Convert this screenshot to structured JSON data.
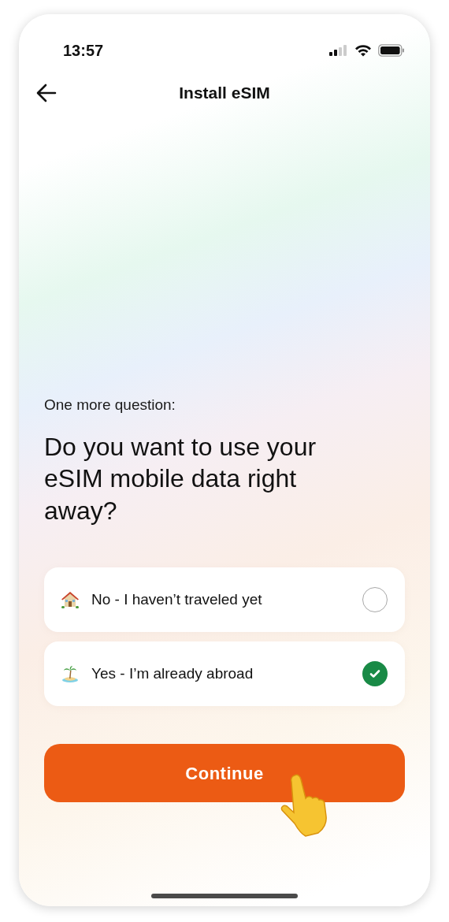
{
  "status_bar": {
    "time": "13:57"
  },
  "header": {
    "title": "Install eSIM"
  },
  "intro": "One more question:",
  "question": "Do you want to use your eSIM mobile data right away?",
  "options": [
    {
      "kind": "house",
      "label": "No - I haven’t traveled yet",
      "selected": false
    },
    {
      "kind": "island",
      "label": "Yes - I’m already abroad",
      "selected": true
    }
  ],
  "button": {
    "label": "Continue"
  }
}
